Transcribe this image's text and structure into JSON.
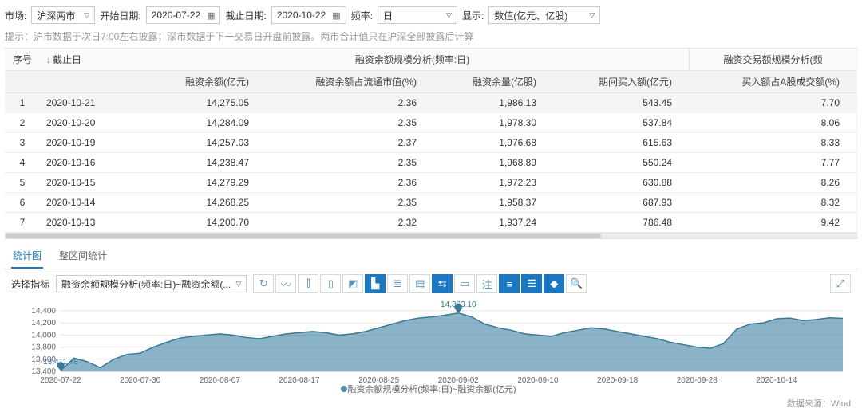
{
  "filters": {
    "market_label": "市场:",
    "market_value": "沪深两市",
    "start_label": "开始日期:",
    "start_value": "2020-07-22",
    "end_label": "截止日期:",
    "end_value": "2020-10-22",
    "freq_label": "频率:",
    "freq_value": "日",
    "display_label": "显示:",
    "display_value": "数值(亿元、亿股)"
  },
  "hint": "提示：沪市数据于次日7:00左右披露；深市数据于下一交易日开盘前披露。两市合计值只在沪深全部披露后计算",
  "table": {
    "group_a": "融资余额规模分析(频率:日)",
    "group_b": "融资交易额规模分析(频",
    "headers": {
      "seq": "序号",
      "date": "截止日",
      "yue": "融资余额(亿元)",
      "pct": "融资余额占流通市值(%)",
      "qty": "融资余量(亿股)",
      "buy": "期间买入额(亿元)",
      "bpct": "买入额占A股成交额(%)"
    },
    "rows": [
      {
        "seq": "1",
        "date": "2020-10-21",
        "yue": "14,275.05",
        "pct": "2.36",
        "qty": "1,986.13",
        "buy": "543.45",
        "bpct": "7.70"
      },
      {
        "seq": "2",
        "date": "2020-10-20",
        "yue": "14,284.09",
        "pct": "2.35",
        "qty": "1,978.30",
        "buy": "537.84",
        "bpct": "8.06"
      },
      {
        "seq": "3",
        "date": "2020-10-19",
        "yue": "14,257.03",
        "pct": "2.37",
        "qty": "1,976.68",
        "buy": "615.63",
        "bpct": "8.33"
      },
      {
        "seq": "4",
        "date": "2020-10-16",
        "yue": "14,238.47",
        "pct": "2.35",
        "qty": "1,968.89",
        "buy": "550.24",
        "bpct": "7.77"
      },
      {
        "seq": "5",
        "date": "2020-10-15",
        "yue": "14,279.29",
        "pct": "2.36",
        "qty": "1,972.23",
        "buy": "630.88",
        "bpct": "8.26"
      },
      {
        "seq": "6",
        "date": "2020-10-14",
        "yue": "14,268.25",
        "pct": "2.35",
        "qty": "1,958.37",
        "buy": "687.93",
        "bpct": "8.32"
      },
      {
        "seq": "7",
        "date": "2020-10-13",
        "yue": "14,200.70",
        "pct": "2.32",
        "qty": "1,937.24",
        "buy": "786.48",
        "bpct": "9.42"
      }
    ]
  },
  "tabs": {
    "a": "统计图",
    "b": "整区间统计"
  },
  "chartbar": {
    "indicator_label": "选择指标",
    "indicator_value": "融资余额规模分析(频率:日)~融资余额(...",
    "tools": {
      "reset": "↻",
      "line": "〰",
      "bar": "⫿",
      "candle": "▯",
      "marker": "◩",
      "area": "▙",
      "stack": "≣",
      "fill": "▤",
      "swap": "⇆",
      "box": "▭",
      "note": "注",
      "list": "≡",
      "list2": "☰",
      "paint": "◆",
      "zoom": "🔍",
      "pop": "⤢"
    }
  },
  "chart_data": {
    "type": "area",
    "title": "",
    "xlabel": "",
    "ylabel": "",
    "ylim": [
      13400,
      14400
    ],
    "x_ticks": [
      "2020-07-22",
      "2020-07-30",
      "2020-08-07",
      "2020-08-17",
      "2020-08-25",
      "2020-09-02",
      "2020-09-10",
      "2020-09-18",
      "2020-09-28",
      "2020-10-14"
    ],
    "y_ticks": [
      13400,
      13600,
      13800,
      14000,
      14200,
      14400
    ],
    "legend": "融资余额规模分析(频率:日)~融资余额(亿元)",
    "min_marker": {
      "date": "2020-07-22",
      "value": 13411.78,
      "label": "13,411.78"
    },
    "max_marker": {
      "date": "2020-09-02",
      "value": 14363.1,
      "label": "14,363.10"
    },
    "series": [
      {
        "name": "融资余额(亿元)",
        "x": [
          "2020-07-22",
          "2020-07-23",
          "2020-07-24",
          "2020-07-27",
          "2020-07-28",
          "2020-07-29",
          "2020-07-30",
          "2020-07-31",
          "2020-08-03",
          "2020-08-04",
          "2020-08-05",
          "2020-08-06",
          "2020-08-07",
          "2020-08-10",
          "2020-08-11",
          "2020-08-12",
          "2020-08-13",
          "2020-08-14",
          "2020-08-17",
          "2020-08-18",
          "2020-08-19",
          "2020-08-20",
          "2020-08-21",
          "2020-08-24",
          "2020-08-25",
          "2020-08-26",
          "2020-08-27",
          "2020-08-28",
          "2020-08-31",
          "2020-09-01",
          "2020-09-02",
          "2020-09-03",
          "2020-09-04",
          "2020-09-07",
          "2020-09-08",
          "2020-09-09",
          "2020-09-10",
          "2020-09-11",
          "2020-09-14",
          "2020-09-15",
          "2020-09-16",
          "2020-09-17",
          "2020-09-18",
          "2020-09-21",
          "2020-09-22",
          "2020-09-23",
          "2020-09-24",
          "2020-09-25",
          "2020-09-28",
          "2020-09-29",
          "2020-09-30",
          "2020-10-09",
          "2020-10-12",
          "2020-10-13",
          "2020-10-14",
          "2020-10-15",
          "2020-10-16",
          "2020-10-19",
          "2020-10-20",
          "2020-10-21"
        ],
        "values": [
          13411.78,
          13620,
          13560,
          13460,
          13600,
          13680,
          13700,
          13800,
          13880,
          13950,
          13980,
          14000,
          14020,
          14000,
          13960,
          13940,
          13980,
          14020,
          14040,
          14060,
          14040,
          14000,
          14020,
          14060,
          14120,
          14180,
          14240,
          14280,
          14300,
          14330,
          14363.1,
          14300,
          14180,
          14120,
          14080,
          14020,
          14000,
          13980,
          14040,
          14080,
          14120,
          14100,
          14060,
          14020,
          13980,
          13940,
          13880,
          13840,
          13800,
          13780,
          13860,
          14100,
          14180,
          14200.7,
          14268.25,
          14279.29,
          14238.47,
          14257.03,
          14284.09,
          14275.05
        ]
      }
    ]
  },
  "source_label": "数据来源：Wind"
}
